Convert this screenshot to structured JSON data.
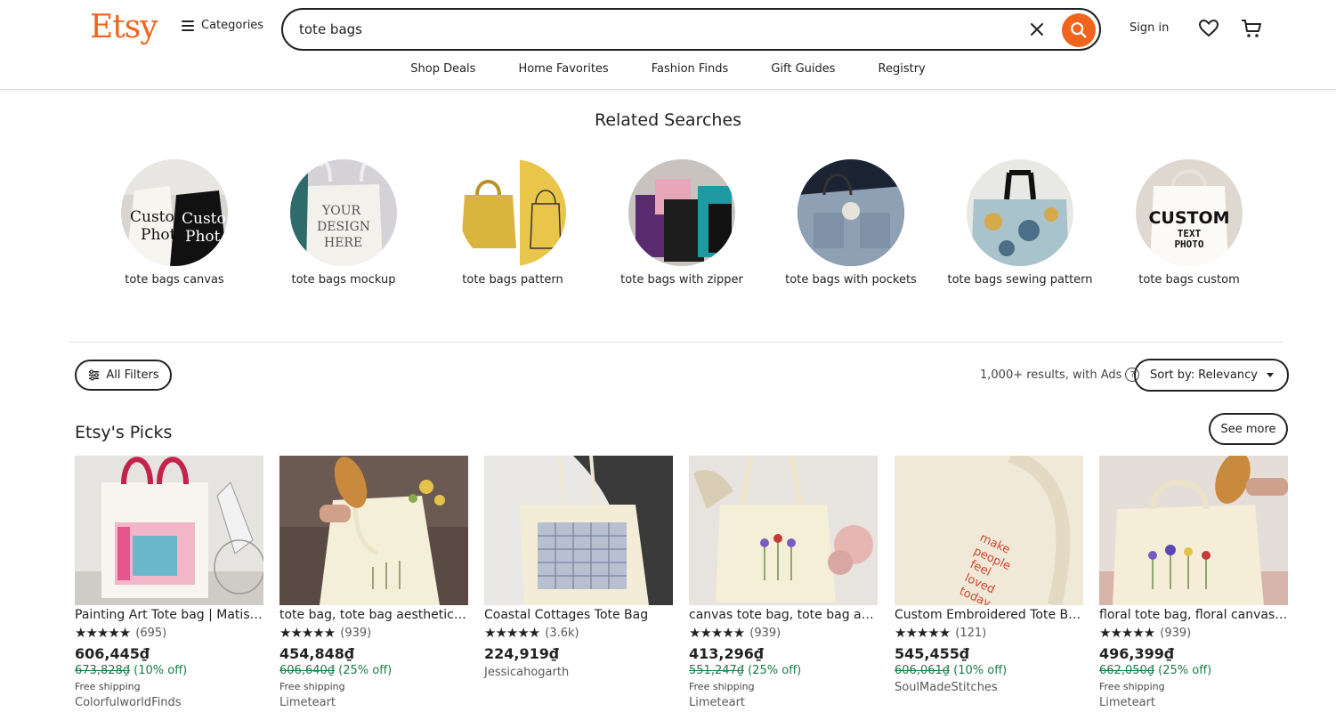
{
  "header": {
    "logo": "Etsy",
    "categories_label": "Categories",
    "search_value": "tote bags",
    "signin_label": "Sign in"
  },
  "subnav": [
    "Shop Deals",
    "Home Favorites",
    "Fashion Finds",
    "Gift Guides",
    "Registry"
  ],
  "related": {
    "title": "Related Searches",
    "items": [
      {
        "label": "tote bags canvas",
        "image_text": "Custom Photo"
      },
      {
        "label": "tote bags mockup",
        "image_text": "YOUR DESIGN HERE"
      },
      {
        "label": "tote bags pattern",
        "image_text": ""
      },
      {
        "label": "tote bags with zipper",
        "image_text": ""
      },
      {
        "label": "tote bags with pockets",
        "image_text": ""
      },
      {
        "label": "tote bags sewing pattern",
        "image_text": ""
      },
      {
        "label": "tote bags custom",
        "image_text": "CUSTOM TEXT PHOTO"
      }
    ]
  },
  "filters": {
    "all_filters_label": "All Filters",
    "results_text": "1,000+ results, with Ads",
    "sort_prefix": "Sort by:",
    "sort_value": "Relevancy"
  },
  "picks": {
    "title": "Etsy's Picks",
    "see_more_label": "See more",
    "items": [
      {
        "title": "Painting Art Tote bag | Matisse Art Tote",
        "stars": "★★★★★",
        "reviews": "(695)",
        "price": "606,445₫",
        "original": "673,828₫",
        "discount": "(10% off)",
        "shipping": "Free shipping",
        "shop": "ColorfulworldFinds"
      },
      {
        "title": "tote bag, tote bag aesthetic, canvas tote",
        "stars": "★★★★★",
        "reviews": "(939)",
        "price": "454,848₫",
        "original": "606,640₫",
        "discount": "(25% off)",
        "shipping": "Free shipping",
        "shop": "Limeteart"
      },
      {
        "title": "Coastal Cottages Tote Bag",
        "stars": "★★★★★",
        "reviews": "(3.6k)",
        "price": "224,919₫",
        "original": "",
        "discount": "",
        "shipping": "",
        "shop": "Jessicahogarth"
      },
      {
        "title": "canvas tote bag, tote bag aesthetic, floral",
        "stars": "★★★★★",
        "reviews": "(939)",
        "price": "413,296₫",
        "original": "551,247₫",
        "discount": "(25% off)",
        "shipping": "Free shipping",
        "shop": "Limeteart"
      },
      {
        "title": "Custom Embroidered Tote Bag, Make People",
        "stars": "★★★★★",
        "reviews": "(121)",
        "price": "545,455₫",
        "original": "606,061₫",
        "discount": "(10% off)",
        "shipping": "",
        "shop": "SoulMadeStitches"
      },
      {
        "title": "floral tote bag, floral canvas tote bag",
        "stars": "★★★★★",
        "reviews": "(939)",
        "price": "496,399₫",
        "original": "662,050₫",
        "discount": "(25% off)",
        "shipping": "Free shipping",
        "shop": "Limeteart"
      }
    ],
    "embroidery_text": "make people feel loved today"
  },
  "colors": {
    "brand": "#f1641e",
    "discount": "#1d7a4a"
  }
}
